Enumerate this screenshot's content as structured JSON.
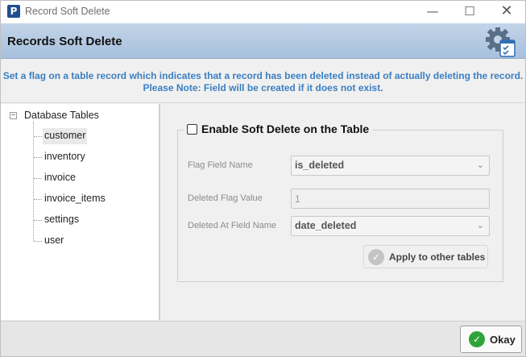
{
  "window": {
    "title": "Record Soft Delete",
    "app_icon_letter": "P",
    "icons": {
      "minimize": "minimize-icon",
      "maximize": "maximize-icon",
      "close": "close-icon"
    }
  },
  "header": {
    "title": "Records Soft Delete",
    "icon": "settings-gear-checklist-icon"
  },
  "description": {
    "line1": "Set a flag on a table record which indicates that a record has been deleted instead of actually deleting the record.",
    "line2": "Please Note: Field will be created if it does not exist.",
    "color": "#3a7fc1"
  },
  "tree": {
    "root_label": "Database Tables",
    "root_toggle": "−",
    "selected": "customer",
    "items": [
      {
        "label": "customer"
      },
      {
        "label": "inventory"
      },
      {
        "label": "invoice"
      },
      {
        "label": "invoice_items"
      },
      {
        "label": "settings"
      },
      {
        "label": "user"
      }
    ]
  },
  "soft_delete": {
    "enable_label": "Enable Soft Delete on the Table",
    "enabled": false,
    "flag_field_label": "Flag Field Name",
    "flag_field_value": "is_deleted",
    "deleted_flag_label": "Deleted Flag Value",
    "deleted_flag_value": "1",
    "deleted_at_label": "Deleted At Field Name",
    "deleted_at_value": "date_deleted",
    "apply_label": "Apply to other tables"
  },
  "footer": {
    "okay_label": "Okay",
    "okay_icon_color": "#2fa33a"
  }
}
